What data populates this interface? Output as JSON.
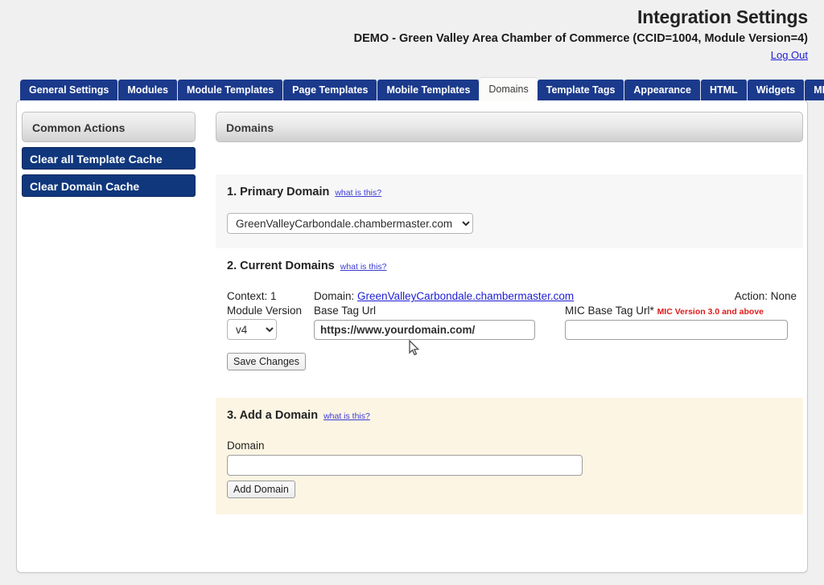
{
  "header": {
    "title": "Integration Settings",
    "subtitle": "DEMO - Green Valley Area Chamber of Commerce (CCID=1004, Module Version=4)",
    "logout_label": "Log Out"
  },
  "tabs": [
    {
      "label": "General Settings",
      "active": false
    },
    {
      "label": "Modules",
      "active": false
    },
    {
      "label": "Module Templates",
      "active": false
    },
    {
      "label": "Page Templates",
      "active": false
    },
    {
      "label": "Mobile Templates",
      "active": false
    },
    {
      "label": "Domains",
      "active": true
    },
    {
      "label": "Template Tags",
      "active": false
    },
    {
      "label": "Appearance",
      "active": false
    },
    {
      "label": "HTML",
      "active": false
    },
    {
      "label": "Widgets",
      "active": false
    },
    {
      "label": "MIC",
      "active": false
    }
  ],
  "sidebar": {
    "header": "Common Actions",
    "actions": [
      {
        "label": "Clear all Template Cache"
      },
      {
        "label": "Clear Domain Cache"
      }
    ]
  },
  "content": {
    "header": "Domains",
    "what_is_this": "what is this?",
    "section1": {
      "title": "1. Primary Domain",
      "selected_domain": "GreenValleyCarbondale.chambermaster.com",
      "options": [
        "GreenValleyCarbondale.chambermaster.com"
      ]
    },
    "section2": {
      "title": "2. Current Domains",
      "context_label": "Context: 1",
      "domain_prefix": "Domain:",
      "domain_link": "GreenValleyCarbondale.chambermaster.com",
      "action_label": "Action: None",
      "module_version_label": "Module Version",
      "module_version_value": "v4",
      "module_version_options": [
        "v4"
      ],
      "base_tag_url_label": "Base Tag Url",
      "base_tag_url_value": "https://www.yourdomain.com/",
      "mic_base_tag_url_label": "MIC Base Tag Url*",
      "mic_base_tag_url_note": "MIC Version 3.0 and above",
      "mic_base_tag_url_value": "",
      "save_label": "Save Changes"
    },
    "section3": {
      "title": "3. Add a Domain",
      "domain_label": "Domain",
      "domain_value": "",
      "domain_placeholder": "",
      "add_label": "Add Domain"
    }
  },
  "colors": {
    "page_background": "#f0f0f0",
    "tab_blue": "#1b3a8c",
    "sidebar_button_blue": "#10377c",
    "link_blue": "#1d1dd4",
    "note_red": "#e01b1b",
    "section_gray": "#f7f7f8",
    "section_cream": "#fcf5e3"
  }
}
